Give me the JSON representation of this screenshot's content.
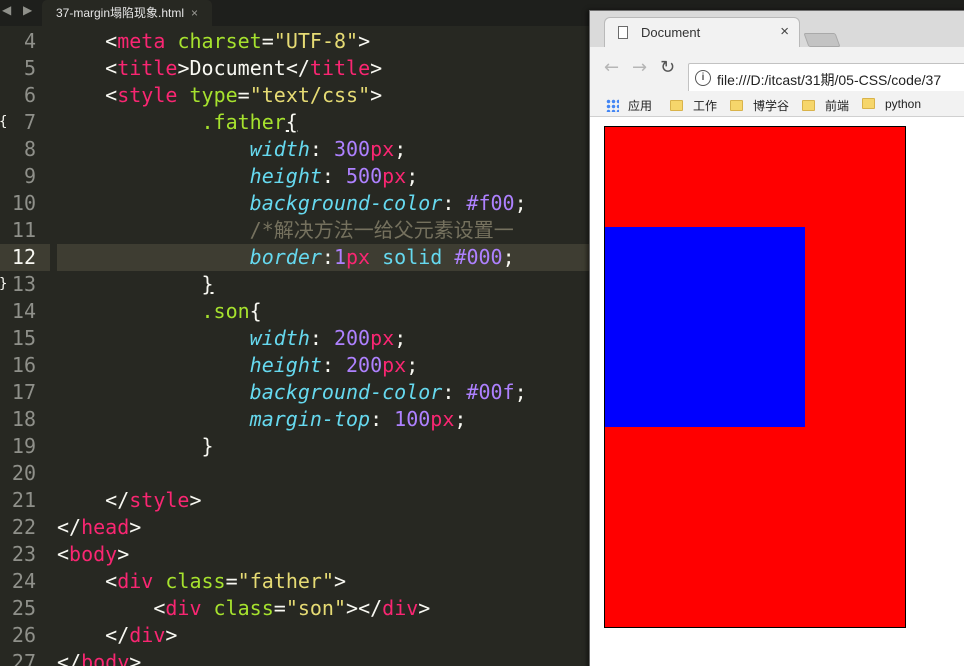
{
  "editor": {
    "tab_title": "37-margin塌陷现象.html",
    "tab_close": "×",
    "nav_arrows": "◀ ▶",
    "current_line": 12,
    "lines": [
      {
        "n": "4",
        "tokens": [
          [
            "    ",
            "pn"
          ],
          [
            "<",
            "pn"
          ],
          [
            "meta",
            "tg"
          ],
          [
            " ",
            "pn"
          ],
          [
            "charset",
            "at"
          ],
          [
            "=",
            "pn"
          ],
          [
            "\"UTF-8\"",
            "st"
          ],
          [
            ">",
            "pn"
          ]
        ]
      },
      {
        "n": "5",
        "tokens": [
          [
            "    ",
            "pn"
          ],
          [
            "<",
            "pn"
          ],
          [
            "title",
            "tg"
          ],
          [
            ">",
            "pn"
          ],
          [
            "Document",
            "pn"
          ],
          [
            "</",
            "pn"
          ],
          [
            "title",
            "tg"
          ],
          [
            ">",
            "pn"
          ]
        ]
      },
      {
        "n": "6",
        "tokens": [
          [
            "    ",
            "pn"
          ],
          [
            "<",
            "pn"
          ],
          [
            "style",
            "tg"
          ],
          [
            " ",
            "pn"
          ],
          [
            "type",
            "at"
          ],
          [
            "=",
            "pn"
          ],
          [
            "\"text/css\"",
            "st"
          ],
          [
            ">",
            "pn"
          ]
        ]
      },
      {
        "n": "7",
        "fold": "{",
        "tokens": [
          [
            "            ",
            "pn"
          ],
          [
            ".father",
            "sel"
          ],
          [
            "{",
            "pn ul"
          ]
        ]
      },
      {
        "n": "8",
        "tokens": [
          [
            "                ",
            "pn"
          ],
          [
            "width",
            "pr"
          ],
          [
            ": ",
            "pn"
          ],
          [
            "300",
            "nm"
          ],
          [
            "px",
            "un"
          ],
          [
            ";",
            "pn"
          ]
        ]
      },
      {
        "n": "9",
        "tokens": [
          [
            "                ",
            "pn"
          ],
          [
            "height",
            "pr"
          ],
          [
            ": ",
            "pn"
          ],
          [
            "500",
            "nm"
          ],
          [
            "px",
            "un"
          ],
          [
            ";",
            "pn"
          ]
        ]
      },
      {
        "n": "10",
        "tokens": [
          [
            "                ",
            "pn"
          ],
          [
            "background-color",
            "pr"
          ],
          [
            ": ",
            "pn"
          ],
          [
            "#f00",
            "nm"
          ],
          [
            ";",
            "pn"
          ]
        ]
      },
      {
        "n": "11",
        "tokens": [
          [
            "                ",
            "pn"
          ],
          [
            "/*解决方法一给父元素设置一",
            "cm"
          ]
        ]
      },
      {
        "n": "12",
        "tokens": [
          [
            "                ",
            "pn"
          ],
          [
            "border",
            "pr"
          ],
          [
            ":",
            "pn"
          ],
          [
            "1",
            "nm"
          ],
          [
            "px",
            "un"
          ],
          [
            " ",
            "pn"
          ],
          [
            "solid",
            "kw"
          ],
          [
            " ",
            "pn"
          ],
          [
            "#000",
            "nm"
          ],
          [
            ";",
            "pn"
          ]
        ]
      },
      {
        "n": "13",
        "fold": "}",
        "tokens": [
          [
            "            ",
            "pn"
          ],
          [
            "}",
            "pn ul"
          ]
        ]
      },
      {
        "n": "14",
        "tokens": [
          [
            "            ",
            "pn"
          ],
          [
            ".son",
            "sel"
          ],
          [
            "{",
            "pn"
          ]
        ]
      },
      {
        "n": "15",
        "tokens": [
          [
            "                ",
            "pn"
          ],
          [
            "width",
            "pr"
          ],
          [
            ": ",
            "pn"
          ],
          [
            "200",
            "nm"
          ],
          [
            "px",
            "un"
          ],
          [
            ";",
            "pn"
          ]
        ]
      },
      {
        "n": "16",
        "tokens": [
          [
            "                ",
            "pn"
          ],
          [
            "height",
            "pr"
          ],
          [
            ": ",
            "pn"
          ],
          [
            "200",
            "nm"
          ],
          [
            "px",
            "un"
          ],
          [
            ";",
            "pn"
          ]
        ]
      },
      {
        "n": "17",
        "tokens": [
          [
            "                ",
            "pn"
          ],
          [
            "background-color",
            "pr"
          ],
          [
            ": ",
            "pn"
          ],
          [
            "#00f",
            "nm"
          ],
          [
            ";",
            "pn"
          ]
        ]
      },
      {
        "n": "18",
        "tokens": [
          [
            "                ",
            "pn"
          ],
          [
            "margin-top",
            "pr"
          ],
          [
            ": ",
            "pn"
          ],
          [
            "100",
            "nm"
          ],
          [
            "px",
            "un"
          ],
          [
            ";",
            "pn"
          ]
        ]
      },
      {
        "n": "19",
        "tokens": [
          [
            "            ",
            "pn"
          ],
          [
            "}",
            "pn"
          ]
        ]
      },
      {
        "n": "20",
        "tokens": []
      },
      {
        "n": "21",
        "tokens": [
          [
            "    ",
            "pn"
          ],
          [
            "</",
            "pn"
          ],
          [
            "style",
            "tg"
          ],
          [
            ">",
            "pn"
          ]
        ]
      },
      {
        "n": "22",
        "tokens": [
          [
            "</",
            "pn"
          ],
          [
            "head",
            "tg"
          ],
          [
            ">",
            "pn"
          ]
        ]
      },
      {
        "n": "23",
        "tokens": [
          [
            "<",
            "pn"
          ],
          [
            "body",
            "tg"
          ],
          [
            ">",
            "pn"
          ]
        ]
      },
      {
        "n": "24",
        "tokens": [
          [
            "    ",
            "pn"
          ],
          [
            "<",
            "pn"
          ],
          [
            "div",
            "tg"
          ],
          [
            " ",
            "pn"
          ],
          [
            "class",
            "at"
          ],
          [
            "=",
            "pn"
          ],
          [
            "\"father\"",
            "st"
          ],
          [
            ">",
            "pn"
          ]
        ]
      },
      {
        "n": "25",
        "tokens": [
          [
            "        ",
            "pn"
          ],
          [
            "<",
            "pn"
          ],
          [
            "div",
            "tg"
          ],
          [
            " ",
            "pn"
          ],
          [
            "class",
            "at"
          ],
          [
            "=",
            "pn"
          ],
          [
            "\"son\"",
            "st"
          ],
          [
            "></",
            "pn"
          ],
          [
            "div",
            "tg"
          ],
          [
            ">",
            "pn"
          ]
        ]
      },
      {
        "n": "26",
        "tokens": [
          [
            "    ",
            "pn"
          ],
          [
            "</",
            "pn"
          ],
          [
            "div",
            "tg"
          ],
          [
            ">",
            "pn"
          ]
        ]
      },
      {
        "n": "27",
        "tokens": [
          [
            "</",
            "pn"
          ],
          [
            "body",
            "tg"
          ],
          [
            ">",
            "pn"
          ]
        ]
      }
    ]
  },
  "browser": {
    "tab_title": "Document",
    "tab_close": "×",
    "nav_back": "←",
    "nav_forward": "→",
    "nav_reload": "↻",
    "info_glyph": "i",
    "url": "file:///D:/itcast/31期/05-CSS/code/37",
    "bookmarks": [
      {
        "label": "应用",
        "type": "apps"
      },
      {
        "label": "工作",
        "type": "folder"
      },
      {
        "label": "博学谷",
        "type": "folder"
      },
      {
        "label": "前端",
        "type": "folder"
      },
      {
        "label": "python",
        "type": "folder"
      }
    ],
    "page": {
      "father_color": "#ff0000",
      "son_color": "#0000ff",
      "border_color": "#000000"
    }
  }
}
